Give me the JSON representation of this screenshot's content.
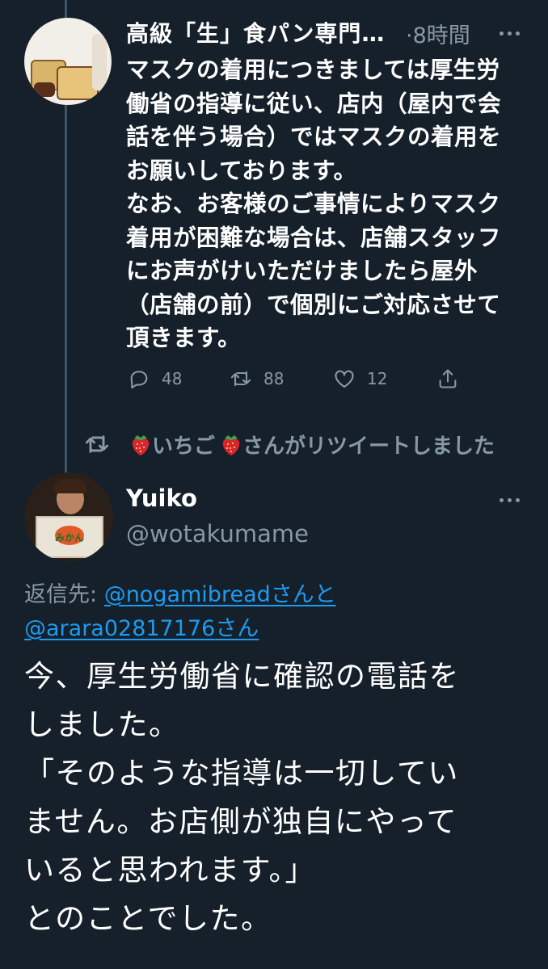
{
  "tweet1": {
    "author_name": "高級「生」食パン専門…",
    "time": "·8時間",
    "body_lines": [
      "マスクの着用につきましては厚生労",
      "働省の指導に従い、店内（屋内で会",
      "話を伴う場合）ではマスクの着用を",
      "お願いしております。",
      "なお、お客様のご事情によりマスク",
      "着用が困難な場合は、店舗スタッフ",
      "にお声がけいただけましたら屋外",
      "（店舗の前）で個別にご対応させて",
      "頂きます。"
    ],
    "actions": {
      "reply_count": "48",
      "retweet_count": "88",
      "like_count": "12"
    }
  },
  "retweet_header": {
    "prefix": "いちご",
    "suffix": "さんがリツイートしました"
  },
  "tweet2": {
    "author_name": "Yuiko",
    "handle": "@wotakumame",
    "avatar_box_text": "みかん",
    "reply_prefix": "返信先: ",
    "reply_to_1": "@nogamibread",
    "reply_mid": "さんと",
    "reply_to_2": "@arara02817176",
    "reply_end": "さん",
    "body_lines": [
      "今、厚生労働省に確認の電話を",
      "しました。",
      "「そのような指導は一切してい",
      "ません。お店側が独自にやって",
      "いると思われます。」",
      "とのことでした。"
    ]
  },
  "colors": {
    "background": "#15202b",
    "text_primary": "#ffffff",
    "text_secondary": "#8899a6",
    "link": "#1d9bf0",
    "thread_line": "#3d5466"
  }
}
